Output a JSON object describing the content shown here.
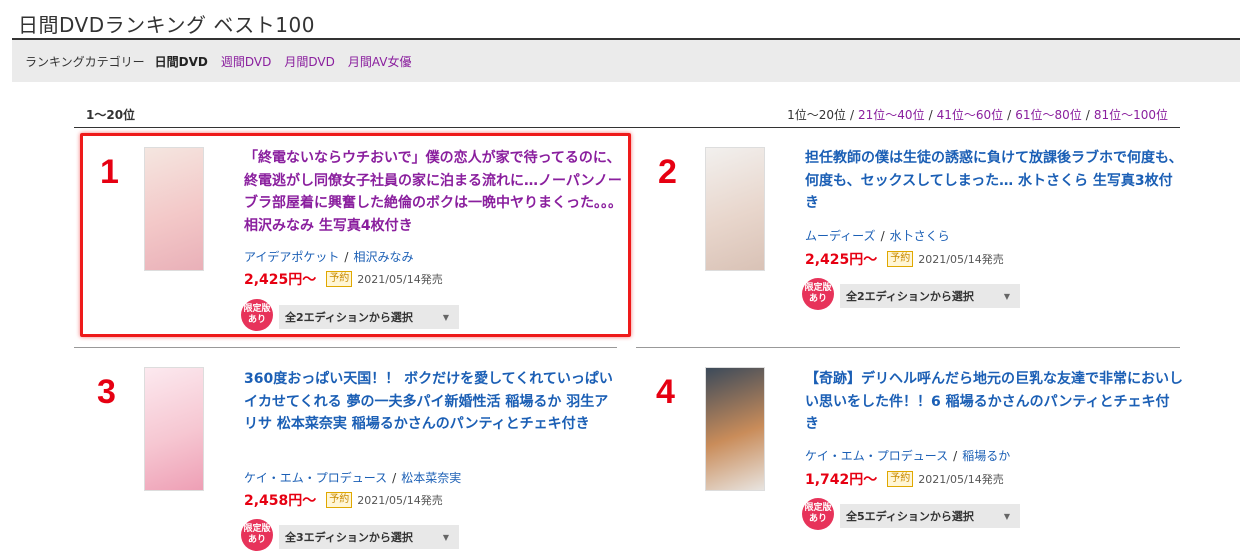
{
  "page": {
    "title": "日間DVDランキング ベスト100"
  },
  "category_bar": {
    "label": "ランキングカテゴリー",
    "items": [
      {
        "label": "日間DVD",
        "active": true
      },
      {
        "label": "週間DVD",
        "active": false
      },
      {
        "label": "月間DVD",
        "active": false
      },
      {
        "label": "月間AV女優",
        "active": false
      }
    ]
  },
  "range": {
    "current": "1〜20位",
    "nav": [
      "1位〜20位",
      "21位〜40位",
      "41位〜60位",
      "61位〜80位",
      "81位〜100位"
    ],
    "separator": "/"
  },
  "items": [
    {
      "rank": "1",
      "title": "「終電ないならウチおいで」僕の恋人が家で待ってるのに、 終電逃がし同僚女子社員の家に泊まる流れに…ノーパンノーブラ部屋着に興奮した絶倫のボクは一晩中ヤりまくった。。。 相沢みなみ 生写真4枚付き",
      "title_color": "purple",
      "maker": "アイデアポケット",
      "actress": "相沢みなみ",
      "price": "2,425円〜",
      "badge": "予約",
      "release": "2021/05/14発売",
      "limited_badge": [
        "限定版",
        "あり"
      ],
      "edition": "全2エディションから選択",
      "thumb_colors": [
        "#f4e6e0",
        "#f3c8c8",
        "#e9b0b8"
      ]
    },
    {
      "rank": "2",
      "title": "担任教師の僕は生徒の誘惑に負けて放課後ラブホで何度も、何度も、セックスしてしまった… 水トさくら 生写真3枚付き",
      "title_color": "blue",
      "maker": "ムーディーズ",
      "actress": "水卜さくら",
      "price": "2,425円〜",
      "badge": "予約",
      "release": "2021/05/14発売",
      "limited_badge": [
        "限定版",
        "あり"
      ],
      "edition": "全2エディションから選択",
      "thumb_colors": [
        "#f2f0ee",
        "#e8d6cc",
        "#d9c2b6"
      ]
    },
    {
      "rank": "3",
      "title": "360度おっぱい天国！！ ボクだけを愛してくれていっぱいイカせてくれる 夢の一夫多パイ新婚性活 稲場るか 羽生アリサ 松本菜奈実 稲場るかさんのパンティとチェキ付き",
      "title_color": "blue",
      "maker": "ケイ・エム・プロデュース",
      "actress": "松本菜奈実",
      "price": "2,458円〜",
      "badge": "予約",
      "release": "2021/05/14発売",
      "limited_badge": [
        "限定版",
        "あり"
      ],
      "edition": "全3エディションから選択",
      "thumb_colors": [
        "#fce9ef",
        "#f6c7d2",
        "#ee9fb5"
      ]
    },
    {
      "rank": "4",
      "title": "【奇跡】デリヘル呼んだら地元の巨乳な友達で非常においしい思いをした件！！6 稲場るかさんのパンティとチェキ付き",
      "title_color": "blue",
      "maker": "ケイ・エム・プロデュース",
      "actress": "稲場るか",
      "price": "1,742円〜",
      "badge": "予約",
      "release": "2021/05/14発売",
      "limited_badge": [
        "限定版",
        "あり"
      ],
      "edition": "全5エディションから選択",
      "thumb_colors": [
        "#3c4a5a",
        "#c98c5a",
        "#e8e4e0"
      ]
    }
  ],
  "colors": {
    "accent_red": "#e60012",
    "link_purple": "#8a1f9e",
    "link_blue": "#1b5fb5",
    "limited_pink": "#e7335a",
    "highlight": "#ee1a1a"
  }
}
